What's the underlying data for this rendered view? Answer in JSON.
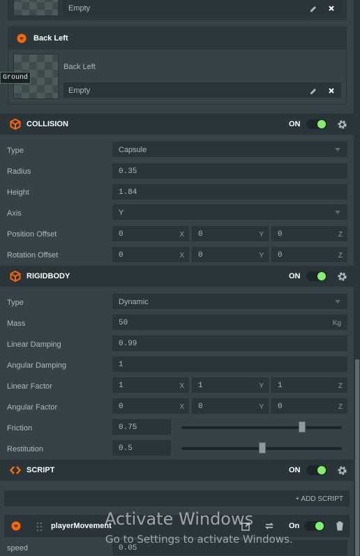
{
  "texture_slots": [
    {
      "label": "",
      "value": "Empty"
    },
    {
      "header": "Back Left",
      "label": "Back Left",
      "value": "Empty"
    }
  ],
  "tooltip": "Ground",
  "collision": {
    "title": "COLLISION",
    "toggle": "ON",
    "type_label": "Type",
    "type_value": "Capsule",
    "radius_label": "Radius",
    "radius_value": "0.35",
    "height_label": "Height",
    "height_value": "1.84",
    "axis_label": "Axis",
    "axis_value": "Y",
    "pos_label": "Position Offset",
    "pos": [
      "0",
      "0",
      "0"
    ],
    "rot_label": "Rotation Offset",
    "rot": [
      "0",
      "0",
      "0"
    ]
  },
  "axes": [
    "X",
    "Y",
    "Z"
  ],
  "rigidbody": {
    "title": "RIGIDBODY",
    "toggle": "ON",
    "type_label": "Type",
    "type_value": "Dynamic",
    "mass_label": "Mass",
    "mass_value": "50",
    "mass_unit": "Kg",
    "lin_damp_label": "Linear Damping",
    "lin_damp_value": "0.99",
    "ang_damp_label": "Angular Damping",
    "ang_damp_value": "1",
    "lin_factor_label": "Linear Factor",
    "lin_factor": [
      "1",
      "1",
      "1"
    ],
    "ang_factor_label": "Angular Factor",
    "ang_factor": [
      "0",
      "0",
      "0"
    ],
    "friction_label": "Friction",
    "friction_value": "0.75",
    "friction_slider": 0.75,
    "restitution_label": "Restitution",
    "restitution_value": "0.5",
    "restitution_slider": 0.5
  },
  "script": {
    "title": "SCRIPT",
    "toggle": "ON",
    "add_label": "+ ADD SCRIPT",
    "item_name": "playerMovement",
    "item_toggle": "On",
    "attr_label": "speed",
    "attr_value": "0.05"
  },
  "watermark": {
    "line1": "Activate Windows",
    "line2": "Go to Settings to activate Windows."
  },
  "colors": {
    "accent": "#ff6600",
    "toggle_on": "#7ff26c",
    "panel": "#2c393c",
    "header": "#293538"
  }
}
